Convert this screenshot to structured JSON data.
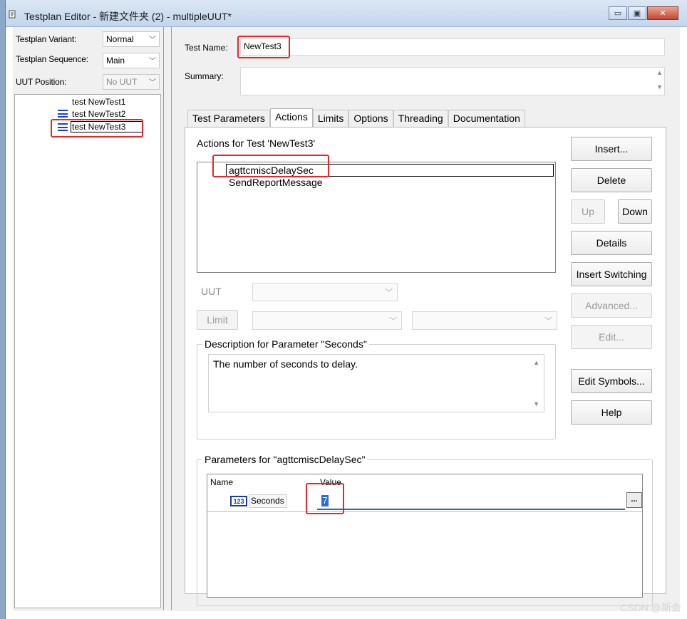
{
  "window": {
    "title": "Testplan Editor - 新建文件夹 (2) - multipleUUT*",
    "minimize": "▭",
    "maximize": "▣",
    "close": "✕"
  },
  "left": {
    "variant_label": "Testplan Variant:",
    "variant_value": "Normal",
    "sequence_label": "Testplan Sequence:",
    "sequence_value": "Main",
    "uut_label": "UUT Position:",
    "uut_value": "No UUT",
    "tests": [
      "test NewTest1",
      "test NewTest2",
      "test NewTest3"
    ]
  },
  "right": {
    "testname_label": "Test Name:",
    "testname_value": "NewTest3",
    "summary_label": "Summary:",
    "tabs": [
      "Test Parameters",
      "Actions",
      "Limits",
      "Options",
      "Threading",
      "Documentation"
    ],
    "active_tab": "Actions",
    "actions_title": "Actions for Test 'NewTest3'",
    "actions": [
      "agttcmiscDelaySec",
      "SendReportMessage"
    ],
    "uut_label": "UUT",
    "limit_button": "Limit",
    "buttons": {
      "insert": "Insert...",
      "delete": "Delete",
      "up": "Up",
      "down": "Down",
      "details": "Details",
      "insert_switching": "Insert Switching",
      "advanced": "Advanced...",
      "edit": "Edit...",
      "edit_symbols": "Edit Symbols...",
      "help": "Help"
    },
    "description_title": "Description for Parameter \"Seconds\"",
    "description_text": "The number of seconds to delay.",
    "params_title": "Parameters for \"agttcmiscDelaySec\"",
    "params_header_name": "Name",
    "params_header_value": "Value",
    "param_icon": "123",
    "param_name": "Seconds",
    "param_value": "7",
    "param_ellipsis": "..."
  },
  "watermark": "CSDN @斯会"
}
